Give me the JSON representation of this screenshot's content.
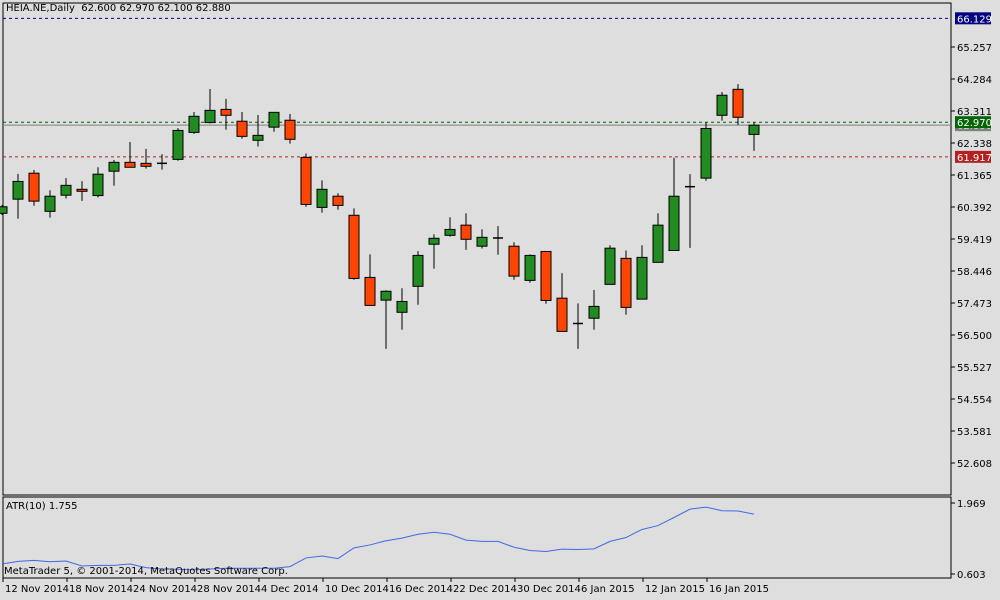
{
  "header": {
    "symbol": "HEIA.NE,Daily",
    "ohlc": "62.600 62.970 62.100 62.880"
  },
  "atr_label": "ATR(10) 1.755",
  "copyright": "MetaTrader 5, © 2001-2014, MetaQuotes Software Corp.",
  "colors": {
    "bull": "#228b22",
    "bear": "#ff4500",
    "atr": "#4169e1",
    "bg": "#dedede"
  },
  "chart_data": [
    {
      "type": "candlestick",
      "title": "HEIA.NE,Daily",
      "ylim": [
        52.1,
        66.6
      ],
      "y_ticks": [
        "65.257",
        "64.284",
        "63.311",
        "62.338",
        "61.365",
        "60.392",
        "59.419",
        "58.446",
        "57.473",
        "56.500",
        "55.527",
        "54.554",
        "53.581",
        "52.608"
      ],
      "x_labels": [
        {
          "index": 0,
          "label": "12 Nov 2014"
        },
        {
          "index": 4,
          "label": "18 Nov 2014"
        },
        {
          "index": 8,
          "label": "24 Nov 2014"
        },
        {
          "index": 12,
          "label": "28 Nov 2014"
        },
        {
          "index": 16,
          "label": "4 Dec 2014"
        },
        {
          "index": 20,
          "label": "10 Dec 2014"
        },
        {
          "index": 24,
          "label": "16 Dec 2014"
        },
        {
          "index": 28,
          "label": "22 Dec 2014"
        },
        {
          "index": 32,
          "label": "30 Dec 2014"
        },
        {
          "index": 36,
          "label": "6 Jan 2015"
        },
        {
          "index": 40,
          "label": "12 Jan 2015"
        },
        {
          "index": 44,
          "label": "16 Jan 2015"
        }
      ],
      "price_lines": [
        {
          "value": 66.129,
          "label": "66.129",
          "color": "#000080",
          "style": "dashed"
        },
        {
          "value": 62.97,
          "label": "62.970",
          "color": "#006400",
          "style": "dashed"
        },
        {
          "value": 62.88,
          "label": "62.880",
          "color": "#808080",
          "style": "solid"
        },
        {
          "value": 61.917,
          "label": "61.917",
          "color": "#b22222",
          "style": "dashed"
        }
      ],
      "ohlc": [
        [
          60.2,
          60.45,
          60.15,
          60.4
        ],
        [
          60.63,
          61.4,
          60.04,
          61.17
        ],
        [
          61.42,
          61.52,
          60.43,
          60.57
        ],
        [
          60.26,
          60.9,
          60.07,
          60.72
        ],
        [
          60.75,
          61.27,
          60.65,
          61.05
        ],
        [
          60.93,
          61.18,
          60.58,
          60.87
        ],
        [
          60.74,
          61.6,
          60.68,
          61.39
        ],
        [
          61.48,
          61.82,
          61.04,
          61.75
        ],
        [
          61.75,
          62.37,
          61.6,
          61.6
        ],
        [
          61.72,
          62.16,
          61.56,
          61.63
        ],
        [
          61.72,
          62.0,
          61.53,
          61.72
        ],
        [
          61.84,
          62.79,
          61.8,
          62.72
        ],
        [
          62.66,
          63.28,
          62.61,
          63.15
        ],
        [
          62.96,
          63.98,
          62.93,
          63.33
        ],
        [
          63.36,
          63.68,
          62.74,
          63.18
        ],
        [
          63.0,
          63.28,
          62.47,
          62.54
        ],
        [
          62.42,
          63.19,
          62.23,
          62.57
        ],
        [
          62.82,
          63.27,
          62.68,
          63.27
        ],
        [
          63.03,
          63.22,
          62.32,
          62.45
        ],
        [
          61.9,
          62.02,
          60.4,
          60.47
        ],
        [
          60.38,
          61.2,
          60.22,
          60.93
        ],
        [
          60.72,
          60.81,
          60.31,
          60.44
        ],
        [
          60.14,
          60.35,
          58.18,
          58.22
        ],
        [
          58.25,
          58.95,
          57.4,
          57.4
        ],
        [
          57.56,
          57.86,
          56.08,
          57.83
        ],
        [
          57.19,
          57.92,
          56.66,
          57.52
        ],
        [
          57.98,
          59.05,
          57.42,
          58.92
        ],
        [
          59.26,
          59.56,
          58.52,
          59.44
        ],
        [
          59.53,
          60.08,
          59.49,
          59.71
        ],
        [
          59.84,
          60.2,
          59.09,
          59.41
        ],
        [
          59.2,
          59.71,
          59.13,
          59.47
        ],
        [
          59.45,
          59.81,
          58.94,
          59.45
        ],
        [
          59.2,
          59.32,
          58.18,
          58.29
        ],
        [
          58.16,
          58.95,
          58.09,
          58.92
        ],
        [
          59.04,
          59.04,
          57.45,
          57.55
        ],
        [
          57.62,
          58.38,
          56.61,
          56.61
        ],
        [
          56.85,
          57.46,
          56.08,
          56.85
        ],
        [
          57.01,
          57.87,
          56.66,
          57.37
        ],
        [
          58.04,
          59.23,
          58.04,
          59.14
        ],
        [
          58.83,
          59.07,
          57.12,
          57.34
        ],
        [
          57.59,
          59.23,
          57.59,
          58.86
        ],
        [
          58.71,
          60.2,
          58.71,
          59.84
        ],
        [
          59.07,
          61.89,
          59.07,
          60.72
        ],
        [
          61.01,
          61.39,
          59.15,
          61.01
        ],
        [
          61.27,
          62.97,
          61.19,
          62.78
        ],
        [
          63.18,
          63.89,
          63.02,
          63.79
        ],
        [
          63.97,
          64.13,
          62.89,
          63.12
        ],
        [
          62.6,
          62.97,
          62.1,
          62.88
        ]
      ]
    },
    {
      "type": "line",
      "title": "ATR(10) 1.755",
      "ylim": [
        0.603,
        1.969
      ],
      "y_ticks": [
        "1.969",
        "0.603"
      ],
      "values": [
        0.795,
        0.845,
        0.864,
        0.839,
        0.852,
        0.758,
        0.77,
        0.77,
        0.795,
        0.726,
        0.7,
        0.695,
        0.683,
        0.7,
        0.714,
        0.714,
        0.714,
        0.714,
        0.745,
        0.912,
        0.95,
        0.9,
        1.106,
        1.162,
        1.243,
        1.293,
        1.367,
        1.405,
        1.367,
        1.255,
        1.23,
        1.23,
        1.118,
        1.056,
        1.037,
        1.081,
        1.075,
        1.087,
        1.23,
        1.305,
        1.46,
        1.535,
        1.69,
        1.851,
        1.89,
        1.82,
        1.815,
        1.755
      ]
    }
  ]
}
